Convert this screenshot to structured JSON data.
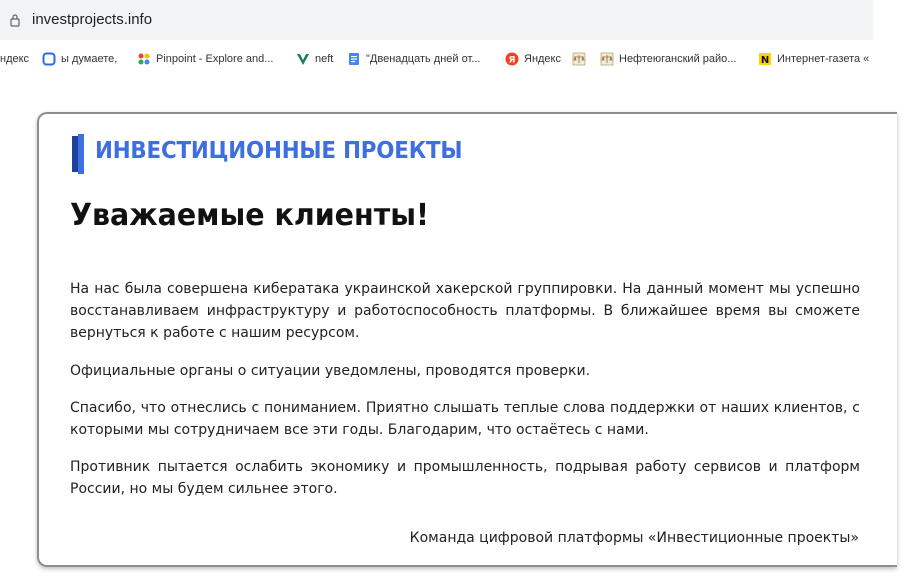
{
  "browser": {
    "url": "investprojects.info",
    "bookmarks": [
      {
        "label": "ндекс",
        "icon": "none"
      },
      {
        "label": "ы думаете,",
        "icon": "square-outline-icon"
      },
      {
        "label": "Pinpoint - Explore and...",
        "icon": "pinpoint-icon"
      },
      {
        "label": "neft",
        "icon": "v-logo-icon"
      },
      {
        "label": "\"Двенадцать дней от...",
        "icon": "doc-icon"
      },
      {
        "label": "Яндекс",
        "icon": "yandex-icon"
      },
      {
        "label": "",
        "icon": "scales-icon"
      },
      {
        "label": "Нефтеюганский райо...",
        "icon": "scales-icon"
      },
      {
        "label": "Интернет-газета «",
        "icon": "n-logo-icon"
      }
    ]
  },
  "page": {
    "logo_text": "ИНВЕСТИЦИОННЫЕ ПРОЕКТЫ",
    "heading": "Уважаемые клиенты!",
    "paragraphs": [
      "На нас была совершена кибератака украинской хакерской группировки. На данный момент мы успешно восстанавливаем инфраструктуру и работоспособность платформы. В ближайшее время вы сможете вернуться к работе с нашим ресурсом.",
      "Официальные органы о ситуации уведомлены, проводятся проверки.",
      "Спасибо, что отнеслись с пониманием. Приятно слышать теплые слова поддержки от наших клиентов, с которыми мы сотрудничаем все эти годы. Благодарим, что остаётесь с нами.",
      "Противник пытается ослабить экономику и промышленность, подрывая работу сервисов и платформ России, но мы будем сильнее этого."
    ],
    "signature": "Команда цифровой платформы «Инвестиционные проекты»"
  },
  "colors": {
    "logo_blue": "#3d6fe0",
    "logo_bar_dark": "#1f3f9c",
    "card_border": "#8e8e8e"
  }
}
